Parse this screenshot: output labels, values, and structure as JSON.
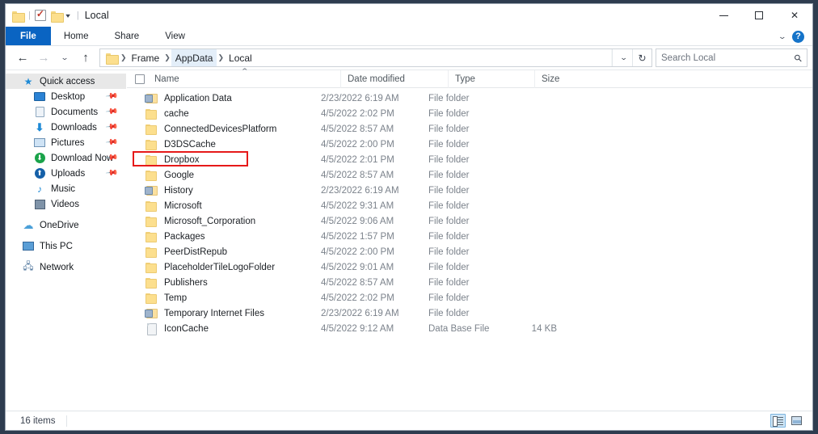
{
  "window": {
    "title": "Local",
    "quick_access_toolbar": [
      {
        "name": "folder-icon",
        "label": ""
      },
      {
        "name": "properties-icon",
        "label": ""
      },
      {
        "name": "new-folder-icon",
        "label": ""
      },
      {
        "name": "customize-qat-caret",
        "label": "▾"
      }
    ],
    "controls": {
      "minimize": "Minimize",
      "maximize": "Maximize",
      "close": "✕"
    }
  },
  "ribbon": {
    "tabs": [
      {
        "label": "File",
        "active": true
      },
      {
        "label": "Home",
        "active": false
      },
      {
        "label": "Share",
        "active": false
      },
      {
        "label": "View",
        "active": false
      }
    ],
    "expand_caret": "⌄",
    "help_label": "?"
  },
  "addressbar": {
    "back": "←",
    "forward": "→",
    "recent": "⌄",
    "up": "↑",
    "breadcrumb": [
      {
        "label": "Frame",
        "active": false
      },
      {
        "label": "AppData",
        "active": true
      },
      {
        "label": "Local",
        "active": false
      }
    ],
    "dropdown_caret": "⌄",
    "refresh": "↻",
    "search_placeholder": "Search Local",
    "search_value": ""
  },
  "sidebar": {
    "items": [
      {
        "label": "Quick access",
        "icon": "star-icon",
        "selected": true,
        "indent": false,
        "pinned": false
      },
      {
        "label": "Desktop",
        "icon": "desktop-icon",
        "selected": false,
        "indent": true,
        "pinned": true
      },
      {
        "label": "Documents",
        "icon": "documents-icon",
        "selected": false,
        "indent": true,
        "pinned": true
      },
      {
        "label": "Downloads",
        "icon": "downloads-icon",
        "selected": false,
        "indent": true,
        "pinned": true
      },
      {
        "label": "Pictures",
        "icon": "pictures-icon",
        "selected": false,
        "indent": true,
        "pinned": true
      },
      {
        "label": "Download Now",
        "icon": "download-now-icon",
        "selected": false,
        "indent": true,
        "pinned": true
      },
      {
        "label": "Uploads",
        "icon": "uploads-icon",
        "selected": false,
        "indent": true,
        "pinned": true
      },
      {
        "label": "Music",
        "icon": "music-icon",
        "selected": false,
        "indent": true,
        "pinned": false
      },
      {
        "label": "Videos",
        "icon": "videos-icon",
        "selected": false,
        "indent": true,
        "pinned": false
      },
      {
        "label": "OneDrive",
        "icon": "onedrive-cloud-icon",
        "selected": false,
        "indent": false,
        "pinned": false
      },
      {
        "label": "This PC",
        "icon": "this-pc-icon",
        "selected": false,
        "indent": false,
        "pinned": false
      },
      {
        "label": "Network",
        "icon": "network-icon",
        "selected": false,
        "indent": false,
        "pinned": false
      }
    ]
  },
  "filelist": {
    "columns": [
      {
        "key": "name",
        "label": "Name",
        "sorted": "asc"
      },
      {
        "key": "date",
        "label": "Date modified",
        "sorted": ""
      },
      {
        "key": "type",
        "label": "Type",
        "sorted": ""
      },
      {
        "key": "size",
        "label": "Size",
        "sorted": ""
      }
    ],
    "sort_caret": "⌃",
    "rows": [
      {
        "name": "Application Data",
        "date": "2/23/2022 6:19 AM",
        "type": "File folder",
        "size": "",
        "icon": "junction-folder-icon"
      },
      {
        "name": "cache",
        "date": "4/5/2022 2:02 PM",
        "type": "File folder",
        "size": "",
        "icon": "folder-icon"
      },
      {
        "name": "ConnectedDevicesPlatform",
        "date": "4/5/2022 8:57 AM",
        "type": "File folder",
        "size": "",
        "icon": "folder-icon"
      },
      {
        "name": "D3DSCache",
        "date": "4/5/2022 2:00 PM",
        "type": "File folder",
        "size": "",
        "icon": "folder-icon"
      },
      {
        "name": "Dropbox",
        "date": "4/5/2022 2:01 PM",
        "type": "File folder",
        "size": "",
        "icon": "folder-icon"
      },
      {
        "name": "Google",
        "date": "4/5/2022 8:57 AM",
        "type": "File folder",
        "size": "",
        "icon": "folder-icon"
      },
      {
        "name": "History",
        "date": "2/23/2022 6:19 AM",
        "type": "File folder",
        "size": "",
        "icon": "junction-folder-icon"
      },
      {
        "name": "Microsoft",
        "date": "4/5/2022 9:31 AM",
        "type": "File folder",
        "size": "",
        "icon": "folder-icon"
      },
      {
        "name": "Microsoft_Corporation",
        "date": "4/5/2022 9:06 AM",
        "type": "File folder",
        "size": "",
        "icon": "folder-icon"
      },
      {
        "name": "Packages",
        "date": "4/5/2022 1:57 PM",
        "type": "File folder",
        "size": "",
        "icon": "folder-icon"
      },
      {
        "name": "PeerDistRepub",
        "date": "4/5/2022 2:00 PM",
        "type": "File folder",
        "size": "",
        "icon": "folder-icon"
      },
      {
        "name": "PlaceholderTileLogoFolder",
        "date": "4/5/2022 9:01 AM",
        "type": "File folder",
        "size": "",
        "icon": "folder-icon"
      },
      {
        "name": "Publishers",
        "date": "4/5/2022 8:57 AM",
        "type": "File folder",
        "size": "",
        "icon": "folder-icon"
      },
      {
        "name": "Temp",
        "date": "4/5/2022 2:02 PM",
        "type": "File folder",
        "size": "",
        "icon": "folder-icon"
      },
      {
        "name": "Temporary Internet Files",
        "date": "2/23/2022 6:19 AM",
        "type": "File folder",
        "size": "",
        "icon": "junction-folder-icon"
      },
      {
        "name": "IconCache",
        "date": "4/5/2022 9:12 AM",
        "type": "Data Base File",
        "size": "14 KB",
        "icon": "database-file-icon"
      }
    ]
  },
  "annotation": {
    "target_row": "Dropbox",
    "color": "#e61919"
  },
  "statusbar": {
    "item_count": "16 items",
    "views": [
      {
        "name": "details-view",
        "label": "Details view",
        "active": true
      },
      {
        "name": "large-icons-view",
        "label": "Large icons view",
        "active": false
      }
    ]
  }
}
